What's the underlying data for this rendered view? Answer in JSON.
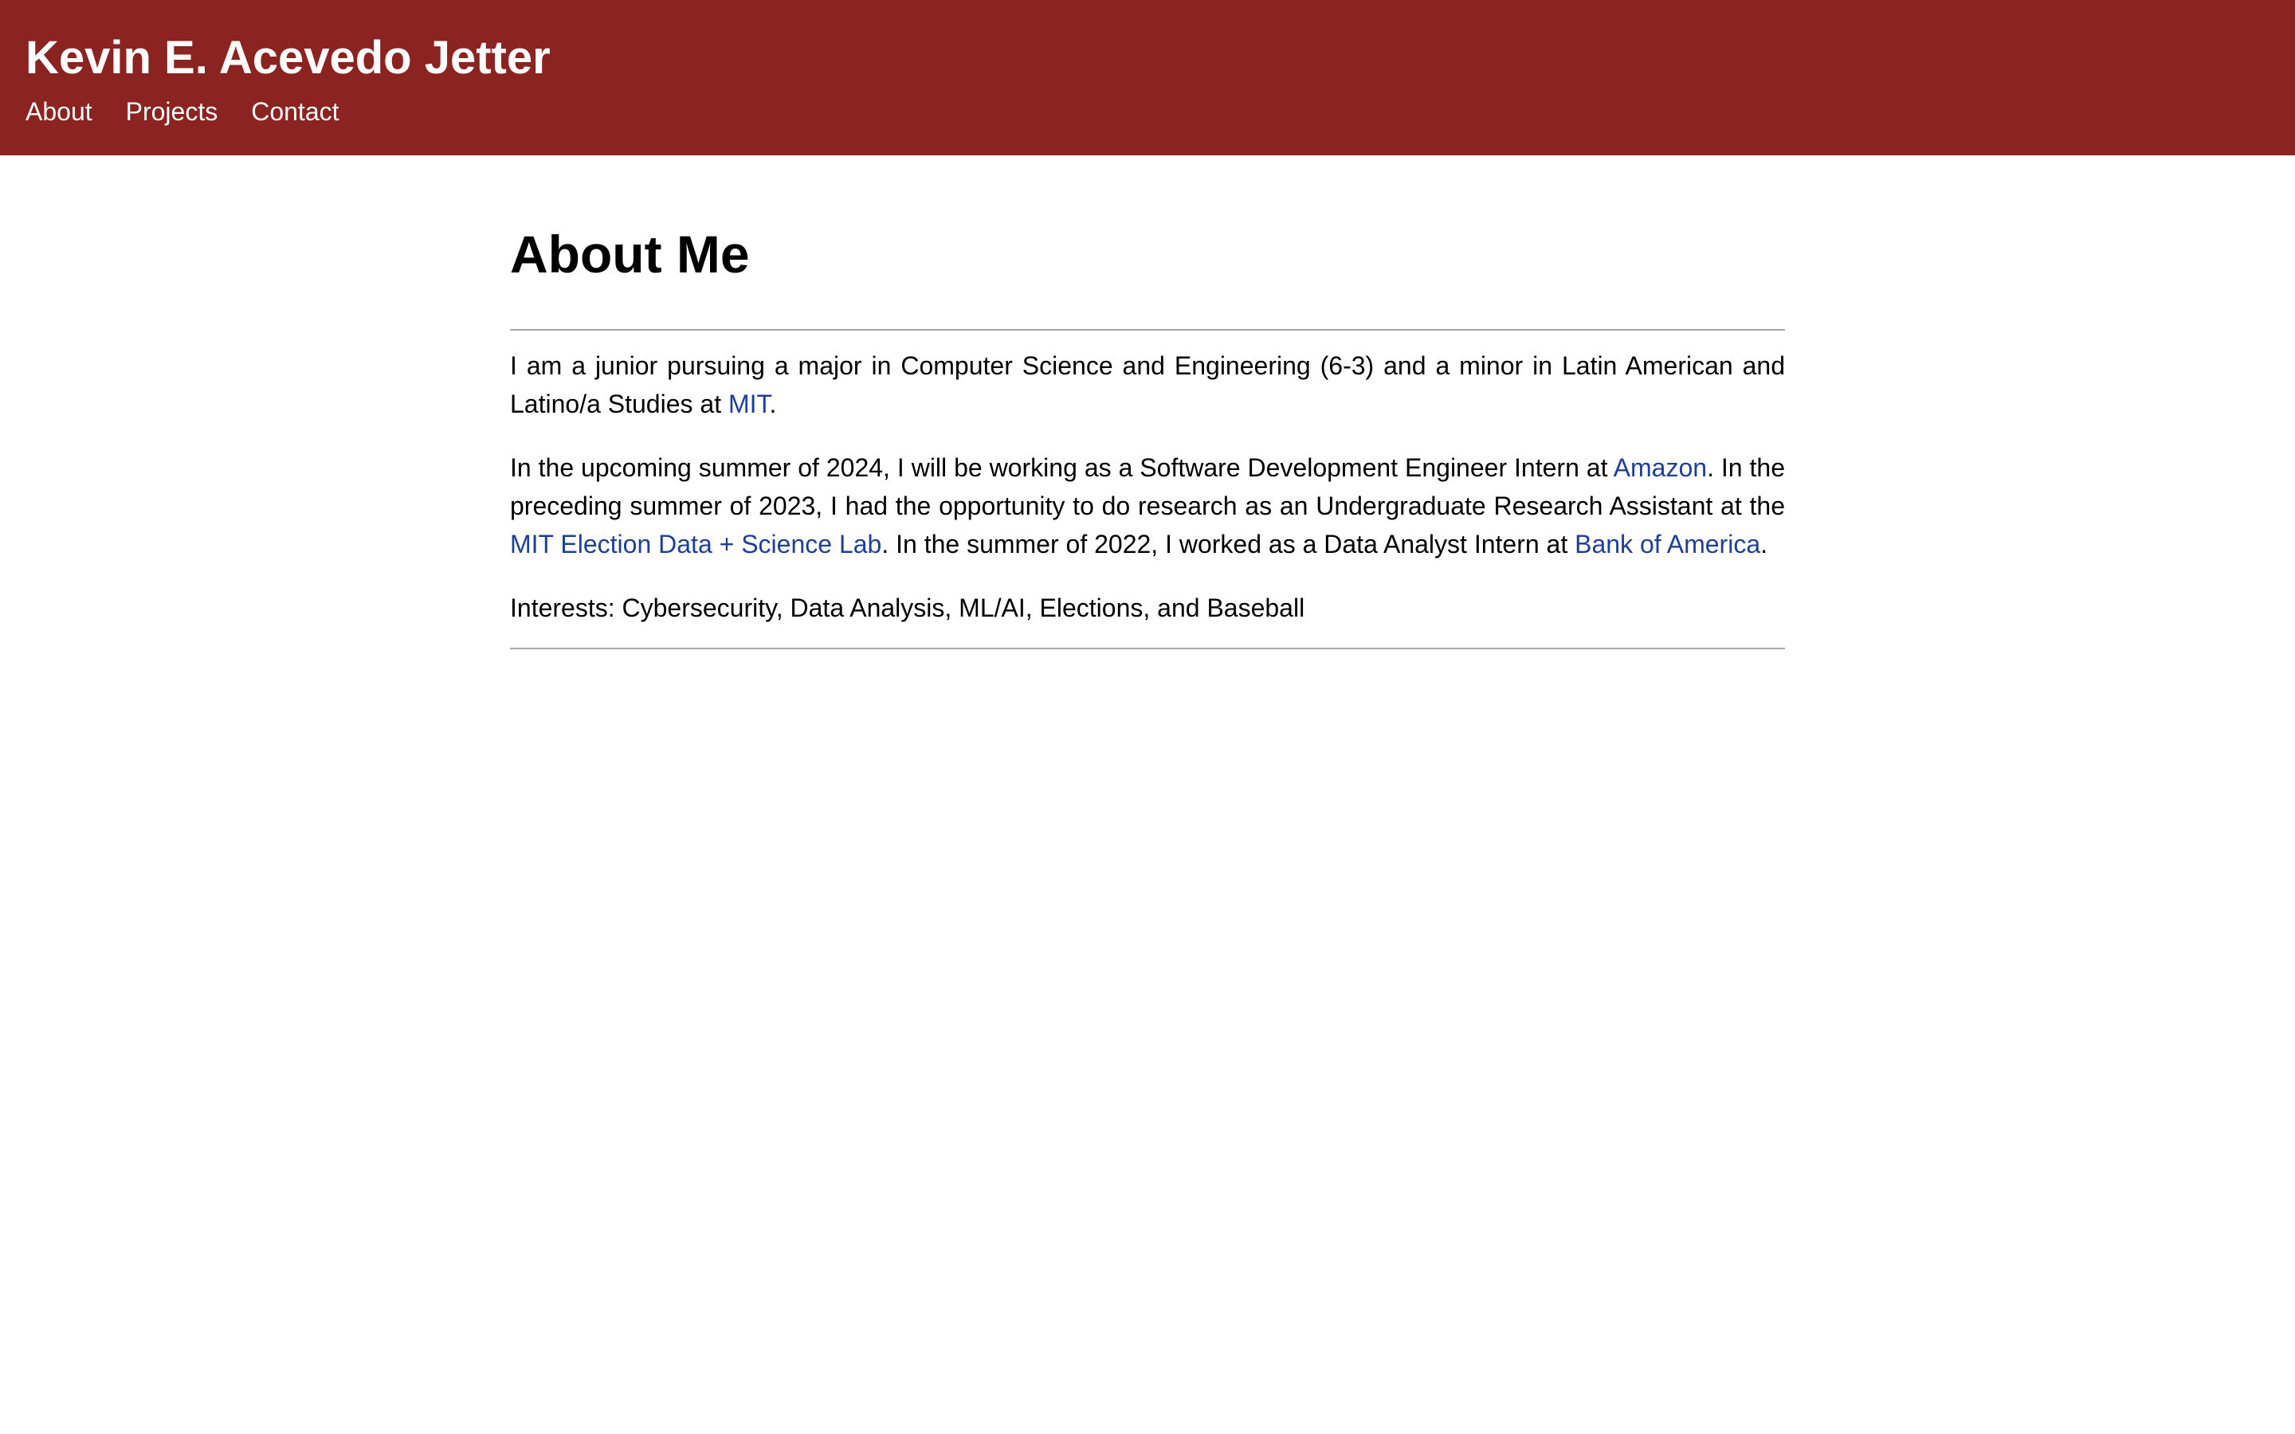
{
  "header": {
    "site_title": "Kevin E. Acevedo Jetter",
    "nav": [
      {
        "label": "About"
      },
      {
        "label": "Projects"
      },
      {
        "label": "Contact"
      }
    ],
    "background_color": "#8b2320"
  },
  "about": {
    "title": "About Me",
    "intro": {
      "text_1": "I am a junior pursuing a major in Computer Science and Engineering (6-3) and a minor in Latin American and Latino/a Studies at ",
      "link_mit": "MIT",
      "text_2": "."
    },
    "experience": {
      "text_1": "In the upcoming summer of 2024, I will be working as a Software Development Engineer Intern at ",
      "link_amazon": "Amazon",
      "text_2": ". In the preceding summer of 2023, I had the opportunity to do research as an Undergraduate Research Assistant at the ",
      "link_election_lab": "MIT Election Data + Science Lab",
      "text_3": ". In the summer of 2022, I worked as a Data Analyst Intern at ",
      "link_bank": "Bank of America",
      "text_4": "."
    },
    "interests": "Interests: Cybersecurity, Data Analysis, ML/AI, Elections, and Baseball"
  },
  "colors": {
    "link": "#1f3f97",
    "divider": "#a7a7a7"
  }
}
